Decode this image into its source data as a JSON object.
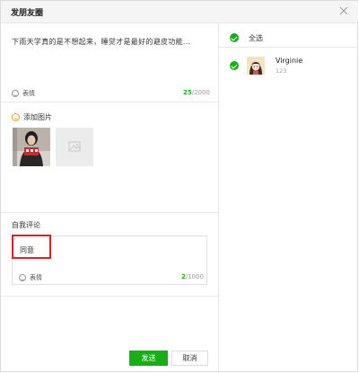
{
  "window": {
    "title": "发朋友圈"
  },
  "post": {
    "text": "下雨天学真的是不想起来，睡觉才是最好的避皮功能...",
    "emoji_label": "表情",
    "count_current": "25",
    "count_max": "/2000"
  },
  "photos": {
    "add_label": "添加图片"
  },
  "comment": {
    "label": "自我评论",
    "text": "同意",
    "emoji_label": "表情",
    "count_current": "2",
    "count_max": "/1000"
  },
  "actions": {
    "send_label": "发送",
    "cancel_label": "取消"
  },
  "recipients": {
    "select_all_label": "全选",
    "contacts": [
      {
        "name": "Virginie",
        "sub": "123"
      }
    ]
  },
  "colors": {
    "accent": "#1aad19",
    "highlight": "#e02020"
  }
}
